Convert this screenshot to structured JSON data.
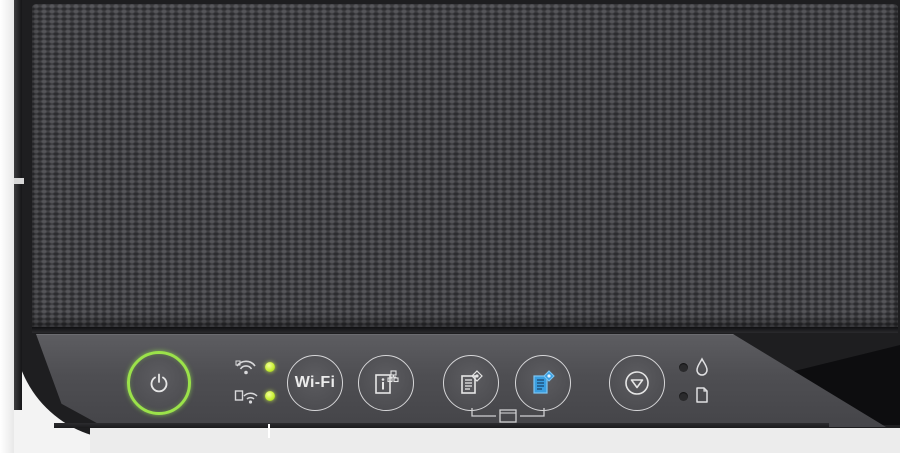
{
  "control_panel": {
    "power_button": {
      "icon": "power-icon",
      "state": "on",
      "ring_color": "#9be24a"
    },
    "wifi_status": {
      "wifi_led": {
        "icon": "wifi-icon",
        "state": "on",
        "color": "#c8ef35"
      },
      "wifi_direct_led": {
        "icon": "wifi-direct-icon",
        "state": "on",
        "color": "#c8ef35"
      }
    },
    "wifi_button": {
      "label": "Wi-Fi"
    },
    "network_info_button": {
      "icon": "network-status-sheet-icon"
    },
    "copy_bw_button": {
      "icon": "copy-black-white-icon"
    },
    "copy_color_button": {
      "icon": "copy-color-icon",
      "accent": "#3a9ee0"
    },
    "copy_group_bracket": {
      "icon": "paper-copy-bracket-icon"
    },
    "stop_button": {
      "icon": "stop-icon"
    },
    "ink_status": {
      "icon": "ink-drop-icon",
      "state": "off"
    },
    "paper_status": {
      "icon": "paper-icon",
      "state": "off"
    }
  }
}
